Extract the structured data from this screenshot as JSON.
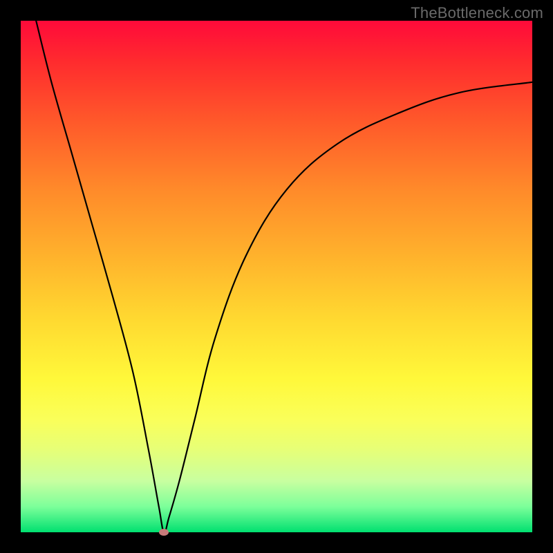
{
  "watermark": "TheBottleneck.com",
  "colors": {
    "frame": "#000000",
    "gradient_top": "#ff0a3a",
    "gradient_bottom": "#00e070",
    "curve": "#000000",
    "min_marker": "#c77b7a"
  },
  "chart_data": {
    "type": "line",
    "title": "",
    "xlabel": "",
    "ylabel": "",
    "xlim": [
      0,
      100
    ],
    "ylim": [
      0,
      100
    ],
    "grid": false,
    "legend": false,
    "description": "V-shaped bottleneck curve plotted over a vertical heat-map gradient (red = high bottleneck, green = low). Curve descends steeply from top-left, reaches a minimum near x≈28 at the bottom, then rises with decreasing slope toward the upper-right.",
    "series": [
      {
        "name": "bottleneck-curve",
        "x": [
          3,
          6,
          10,
          14,
          18,
          22,
          25,
          27,
          28,
          29,
          31,
          34,
          38,
          44,
          52,
          62,
          74,
          86,
          100
        ],
        "values": [
          100,
          88,
          74,
          60,
          46,
          31,
          16,
          5,
          0,
          3,
          10,
          22,
          38,
          54,
          67,
          76,
          82,
          86,
          88
        ]
      }
    ],
    "min_point": {
      "x": 28,
      "y": 0
    }
  }
}
